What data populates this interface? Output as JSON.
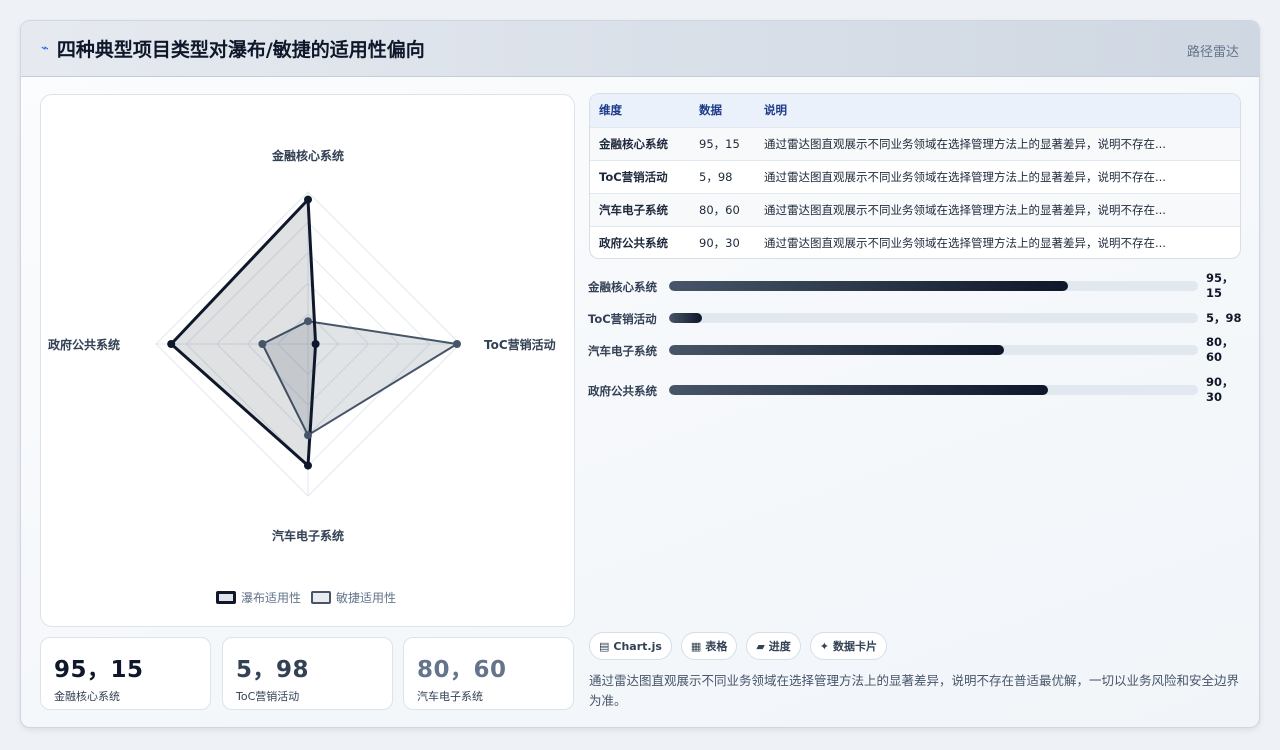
{
  "header": {
    "icon": "line-chart-icon",
    "title": "四种典型项目类型对瀑布/敏捷的适用性偏向",
    "tag": "路径雷达"
  },
  "chart_data": {
    "type": "radar",
    "axes": [
      "金融核心系统",
      "ToC营销活动",
      "汽车电子系统",
      "政府公共系统"
    ],
    "series": [
      {
        "name": "瀑布适用性",
        "values": [
          95,
          5,
          80,
          90
        ],
        "color": "#0f172a"
      },
      {
        "name": "敏捷适用性",
        "values": [
          15,
          98,
          60,
          30
        ],
        "color": "#475569"
      }
    ],
    "range": [
      0,
      100
    ],
    "grid_rings": 5
  },
  "stats": [
    {
      "value": "95，15",
      "label": "金融核心系统",
      "color": "#0f172a"
    },
    {
      "value": "5，98",
      "label": "ToC营销活动",
      "color": "#334155"
    },
    {
      "value": "80，60",
      "label": "汽车电子系统",
      "color": "#64748b"
    }
  ],
  "table": {
    "headers": [
      "维度",
      "数据",
      "说明"
    ],
    "rows": [
      {
        "dim": "金融核心系统",
        "data": "95，15",
        "desc": "通过雷达图直观展示不同业务领域在选择管理方法上的显著差异，说明不存在..."
      },
      {
        "dim": "ToC营销活动",
        "data": "5，98",
        "desc": "通过雷达图直观展示不同业务领域在选择管理方法上的显著差异，说明不存在..."
      },
      {
        "dim": "汽车电子系统",
        "data": "80，60",
        "desc": "通过雷达图直观展示不同业务领域在选择管理方法上的显著差异，说明不存在..."
      },
      {
        "dim": "政府公共系统",
        "data": "90，30",
        "desc": "通过雷达图直观展示不同业务领域在选择管理方法上的显著差异，说明不存在..."
      }
    ]
  },
  "bars": [
    {
      "label": "金融核心系统",
      "value_text": "95，15",
      "fill": 0.755
    },
    {
      "label": "ToC营销活动",
      "value_text": "5，98",
      "fill": 0.062
    },
    {
      "label": "汽车电子系统",
      "value_text": "80，60",
      "fill": 0.633
    },
    {
      "label": "政府公共系统",
      "value_text": "90，30",
      "fill": 0.716
    }
  ],
  "chips": [
    {
      "icon": "chart-icon",
      "glyph": "▤",
      "label": "Chart.js"
    },
    {
      "icon": "table-icon",
      "glyph": "▦",
      "label": "表格"
    },
    {
      "icon": "progress-icon",
      "glyph": "▰",
      "label": "进度"
    },
    {
      "icon": "sparkle-icon",
      "glyph": "✦",
      "label": "数据卡片"
    }
  ],
  "note": "通过雷达图直观展示不同业务领域在选择管理方法上的显著差异，说明不存在普适最优解，一切以业务风险和安全边界为准。"
}
